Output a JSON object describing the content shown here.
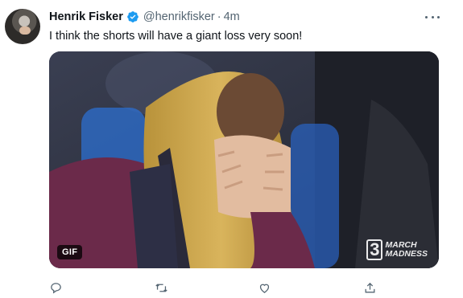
{
  "tweet": {
    "author_name": "Henrik Fisker",
    "handle": "@henrikfisker",
    "separator": "·",
    "time": "4m",
    "text": "I think the shorts will have a giant loss very soon!",
    "media": {
      "badge": "GIF",
      "watermark_line1": "MARCH",
      "watermark_line2": "MADNESS"
    }
  },
  "icons": {
    "verified": "verified-badge-icon",
    "more": "more-horizontal-icon",
    "reply": "reply-icon",
    "retweet": "retweet-icon",
    "like": "like-icon",
    "share": "share-icon"
  },
  "colors": {
    "text": "#0f1419",
    "secondary": "#536471",
    "verified_blue": "#1d9bf0"
  }
}
